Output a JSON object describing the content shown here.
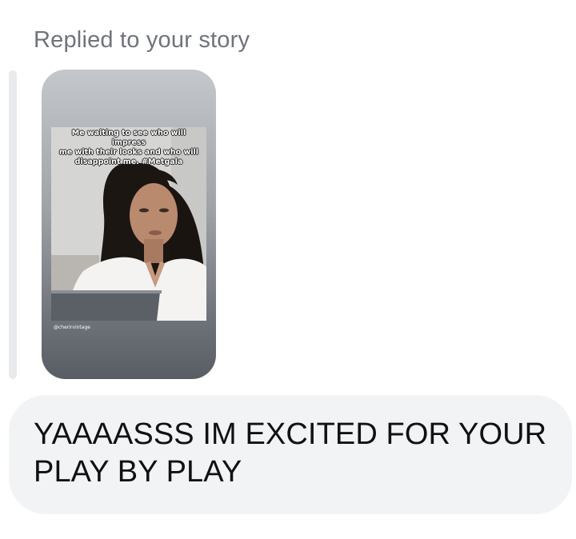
{
  "reply_header": "Replied to your story",
  "story": {
    "caption": "Me waiting to see who will impress\nme with their looks and who will\ndisappoint me. #Metgala",
    "handle": "@cherirvintage"
  },
  "message": {
    "text": "YAAAASSS IM EXCITED FOR YOUR PLAY BY PLAY"
  },
  "colors": {
    "header_text": "#6f737a",
    "bubble_bg": "#f2f3f5",
    "message_text": "#111111",
    "quote_bar": "#e9eaec"
  }
}
